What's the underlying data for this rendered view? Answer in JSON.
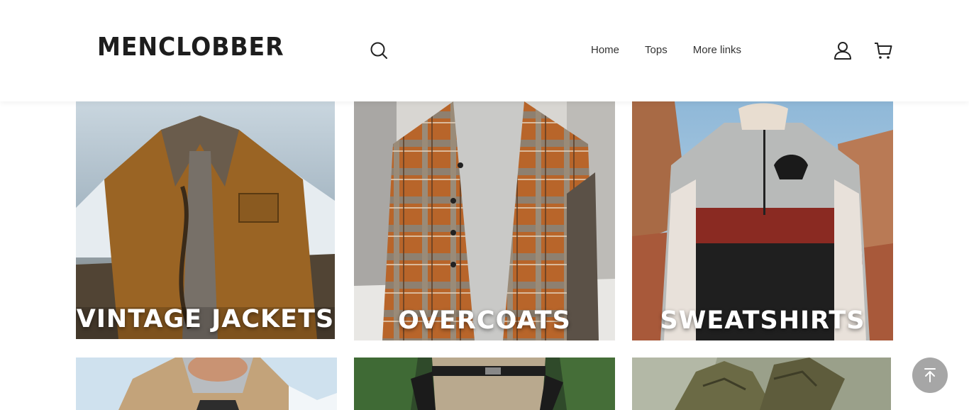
{
  "header": {
    "logo_text": "MENCLOBBER",
    "nav": [
      "Home",
      "Tops",
      "More links"
    ]
  },
  "icons": {
    "search": "search-icon",
    "account": "user-icon",
    "cart": "cart-icon",
    "back_to_top": "arrow-up-icon"
  },
  "collections": [
    {
      "label": "VINTAGE JACKETS"
    },
    {
      "label": "OVERCOATS"
    },
    {
      "label": "SWEATSHIRTS"
    },
    {
      "label": ""
    },
    {
      "label": ""
    },
    {
      "label": ""
    }
  ],
  "colors": {
    "text": "#333333",
    "back_to_top_bg": "#a6a6a6"
  }
}
